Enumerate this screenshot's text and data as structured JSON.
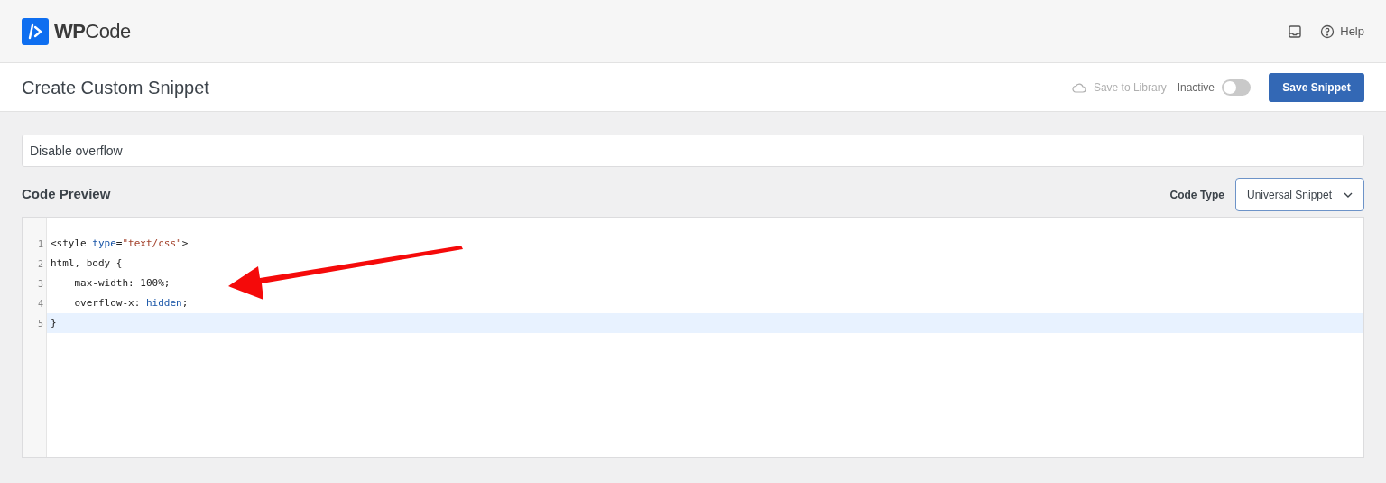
{
  "header": {
    "logo_text_bold": "WP",
    "logo_text": "Code",
    "help": "Help"
  },
  "toolbar": {
    "title": "Create Custom Snippet",
    "save_to_library": "Save to Library",
    "status_label": "Inactive",
    "active": false,
    "save_button": "Save Snippet"
  },
  "snippet_title": {
    "value": "Disable overflow"
  },
  "code_preview": {
    "heading": "Code Preview",
    "code_type_label": "Code Type",
    "code_type_value": "Universal Snippet",
    "lines": [
      {
        "number": "1",
        "active": false,
        "tokens": [
          {
            "kind": "plain",
            "text": "<style "
          },
          {
            "kind": "attr",
            "text": "type"
          },
          {
            "kind": "plain",
            "text": "="
          },
          {
            "kind": "string",
            "text": "\"text/css\""
          },
          {
            "kind": "plain",
            "text": ">"
          }
        ]
      },
      {
        "number": "2",
        "active": false,
        "tokens": [
          {
            "kind": "plain",
            "text": "html, body {"
          }
        ]
      },
      {
        "number": "3",
        "active": false,
        "tokens": [
          {
            "kind": "plain",
            "text": "    max-width: 100%;"
          }
        ]
      },
      {
        "number": "4",
        "active": false,
        "tokens": [
          {
            "kind": "plain",
            "text": "    overflow-x: "
          },
          {
            "kind": "attr",
            "text": "hidden"
          },
          {
            "kind": "plain",
            "text": ";"
          }
        ]
      },
      {
        "number": "5",
        "active": true,
        "tokens": [
          {
            "kind": "plain",
            "text": "}"
          }
        ]
      }
    ]
  }
}
